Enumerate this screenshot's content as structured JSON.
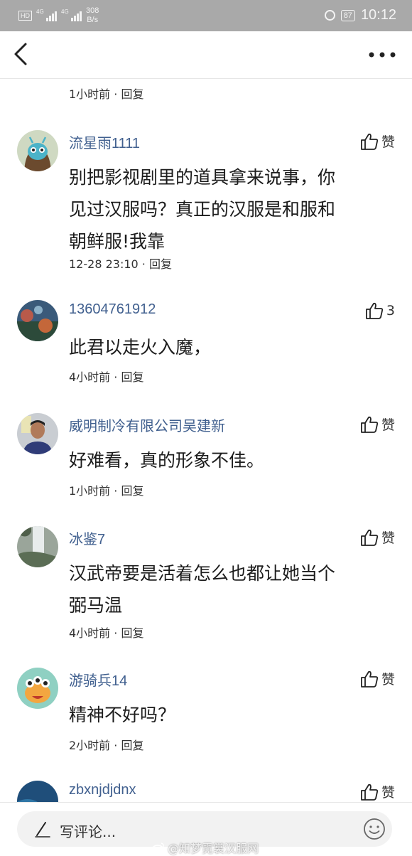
{
  "status_bar": {
    "hd": "HD",
    "sim1_label": "4G",
    "sim2_label": "4G",
    "net_speed_value": "308",
    "net_speed_unit": "B/s",
    "battery": "87",
    "time": "10:12"
  },
  "nav": {
    "back_icon": "chevron-left-icon",
    "more_icon": "more-horizontal-icon"
  },
  "top_meta": {
    "time": "1小时前",
    "separator": "·",
    "reply": "回复"
  },
  "comments": [
    {
      "username": "流星雨1111",
      "lines": [
        "别把影视剧里的道具拿来说事，你",
        "见过汉服吗？真正的汉服是和服和",
        "朝鲜服!我靠"
      ],
      "time": "12-28 23:10",
      "separator": "·",
      "reply": "回复",
      "like_label": "赞"
    },
    {
      "username": "13604761912",
      "lines": [
        "此君以走火入魔，"
      ],
      "time": "4小时前",
      "separator": "·",
      "reply": "回复",
      "like_label": "3"
    },
    {
      "username": "威明制冷有限公司吴建新",
      "lines": [
        "好难看，真的形象不佳。"
      ],
      "time": "1小时前",
      "separator": "·",
      "reply": "回复",
      "like_label": "赞"
    },
    {
      "username": "冰鉴7",
      "lines": [
        "汉武帝要是活着怎么也都让她当个",
        "弼马温"
      ],
      "time": "4小时前",
      "separator": "·",
      "reply": "回复",
      "like_label": "赞"
    },
    {
      "username": "游骑兵14",
      "lines": [
        "精神不好吗？"
      ],
      "time": "2小时前",
      "separator": "·",
      "reply": "回复",
      "like_label": "赞"
    },
    {
      "username": "zbxnjdjdnx",
      "lines": [],
      "like_label": "赞"
    }
  ],
  "bottom": {
    "placeholder": "写评论...",
    "emoji_icon": "smiley-icon",
    "watermark": "@知梦霓裳汉服网"
  },
  "colors": {
    "status_bar_bg": "#a9a9a9",
    "username": "#41608f",
    "text": "#1c1c1c",
    "input_bg": "#f2f2f2"
  }
}
